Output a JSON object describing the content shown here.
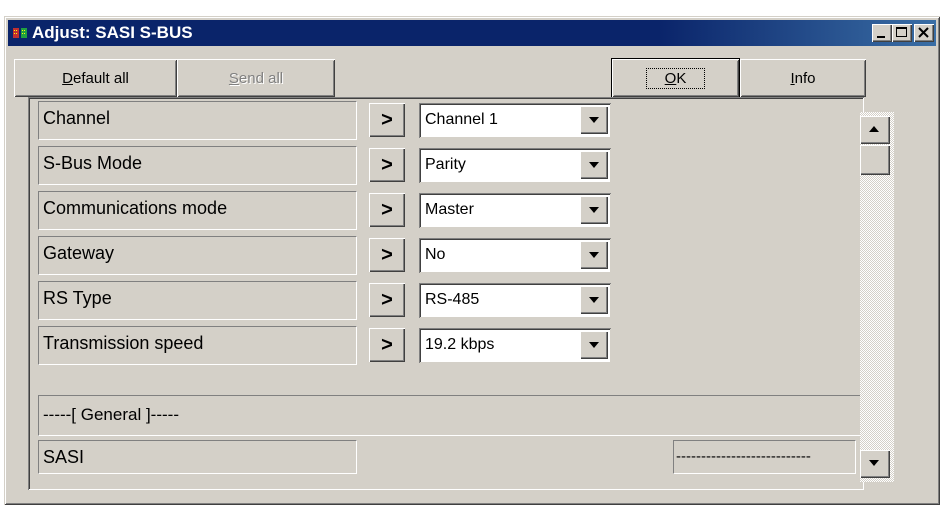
{
  "window": {
    "title": "Adjust: SASI S-BUS",
    "minimize_icon": "minimize-icon",
    "maximize_icon": "maximize-icon",
    "close_icon": "close-icon"
  },
  "toolbar": {
    "default_all": {
      "mnemonic": "D",
      "rest": "efault all"
    },
    "send_all": {
      "mnemonic": "S",
      "rest": "end all"
    },
    "ok": {
      "mnemonic": "O",
      "rest": "K"
    },
    "info": {
      "mnemonic": "I",
      "rest": "nfo"
    }
  },
  "settings": [
    {
      "label": "Channel",
      "button": ">",
      "value": "Channel 1"
    },
    {
      "label": "S-Bus Mode",
      "button": ">",
      "value": "Parity"
    },
    {
      "label": "Communications mode",
      "button": ">",
      "value": "Master"
    },
    {
      "label": "Gateway",
      "button": ">",
      "value": "No"
    },
    {
      "label": "RS Type",
      "button": ">",
      "value": "RS-485"
    },
    {
      "label": "Transmission speed",
      "button": ">",
      "value": "19.2 kbps"
    }
  ],
  "section": {
    "label": "-----[ General ]-----"
  },
  "sasi_row": {
    "label": "SASI",
    "value": "---------------------------"
  },
  "colors": {
    "titlebar": "#0a246a",
    "face": "#d4d0c8"
  }
}
